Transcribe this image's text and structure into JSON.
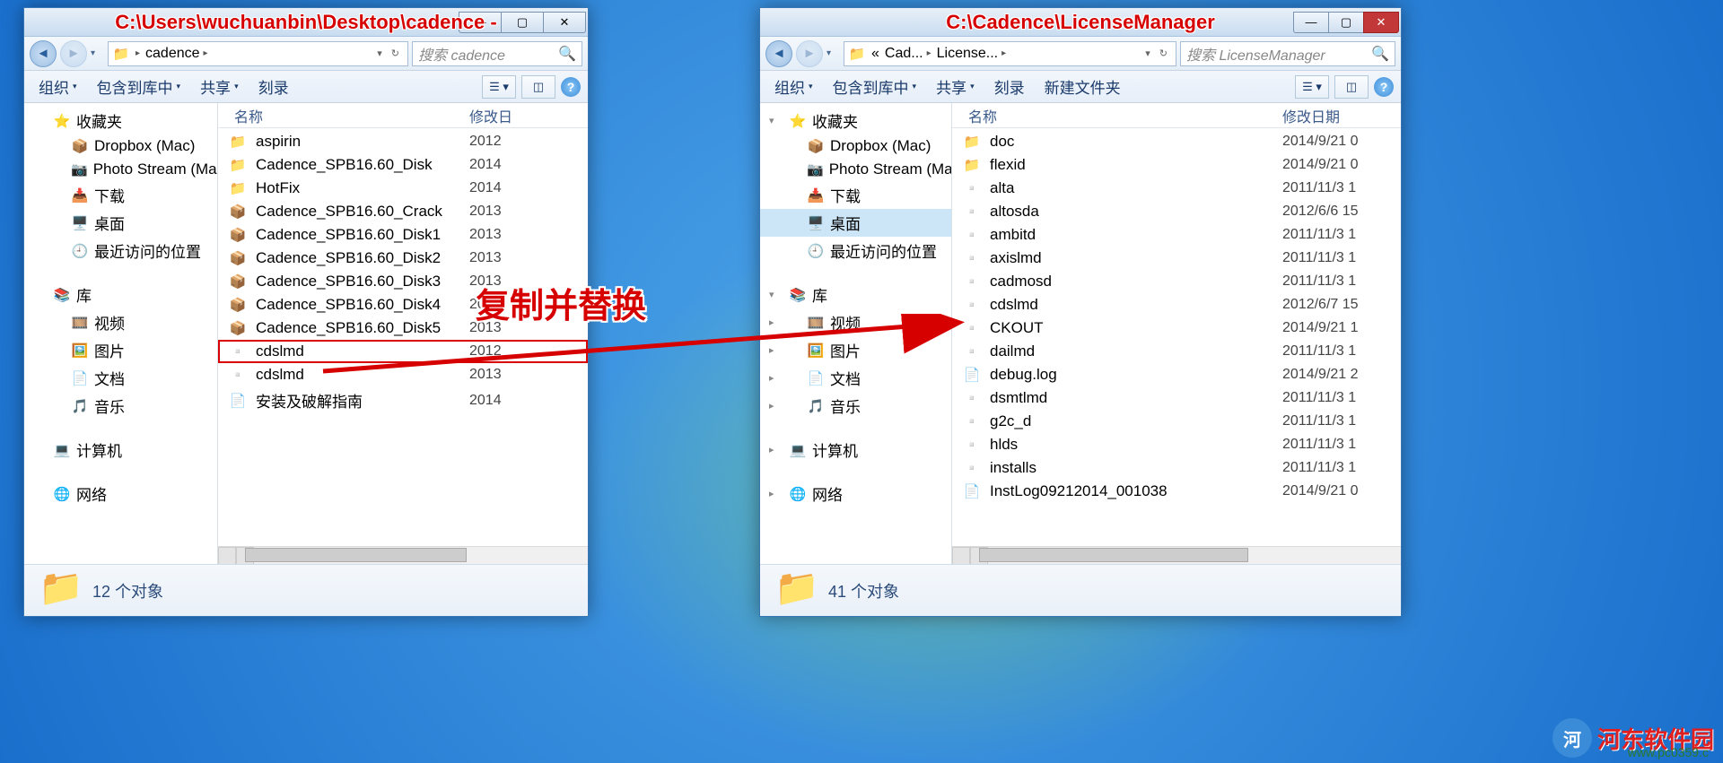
{
  "annotations": {
    "copy_replace": "复制并替换",
    "watermark_text": "河东软件园",
    "watermark_url": "www.pc0359.c"
  },
  "window1": {
    "title_path": "C:\\Users\\wuchuanbin\\Desktop\\cadence -",
    "breadcrumb": [
      "cadence"
    ],
    "search_placeholder": "搜索 cadence",
    "toolbar": {
      "organize": "组织",
      "include": "包含到库中",
      "share": "共享",
      "burn": "刻录"
    },
    "columns": {
      "name": "名称",
      "date": "修改日"
    },
    "nav": {
      "favorites": "收藏夹",
      "fav_items": [
        "Dropbox (Mac)",
        "Photo Stream (Mac)",
        "下载",
        "桌面",
        "最近访问的位置"
      ],
      "libs": "库",
      "lib_items": [
        "视频",
        "图片",
        "文档",
        "音乐"
      ],
      "computer": "计算机",
      "network": "网络"
    },
    "files": [
      {
        "icon": "folder",
        "name": "aspirin",
        "date": "2012"
      },
      {
        "icon": "folder",
        "name": "Cadence_SPB16.60_Disk",
        "date": "2014"
      },
      {
        "icon": "folder",
        "name": "HotFix",
        "date": "2014"
      },
      {
        "icon": "archive",
        "name": "Cadence_SPB16.60_Crack",
        "date": "2013"
      },
      {
        "icon": "archive",
        "name": "Cadence_SPB16.60_Disk1",
        "date": "2013"
      },
      {
        "icon": "archive",
        "name": "Cadence_SPB16.60_Disk2",
        "date": "2013"
      },
      {
        "icon": "archive",
        "name": "Cadence_SPB16.60_Disk3",
        "date": "2013"
      },
      {
        "icon": "archive",
        "name": "Cadence_SPB16.60_Disk4",
        "date": "2013"
      },
      {
        "icon": "archive",
        "name": "Cadence_SPB16.60_Disk5",
        "date": "2013"
      },
      {
        "icon": "exe",
        "name": "cdslmd",
        "date": "2012",
        "highlight": true
      },
      {
        "icon": "exe",
        "name": "cdslmd",
        "date": "2013"
      },
      {
        "icon": "text",
        "name": "安装及破解指南",
        "date": "2014"
      }
    ],
    "status": "12 个对象"
  },
  "window2": {
    "title_path": "C:\\Cadence\\LicenseManager",
    "breadcrumb": [
      "«",
      "Cad...",
      "License..."
    ],
    "search_placeholder": "搜索 LicenseManager",
    "toolbar": {
      "organize": "组织",
      "include": "包含到库中",
      "share": "共享",
      "burn": "刻录",
      "newfolder": "新建文件夹"
    },
    "columns": {
      "name": "名称",
      "date": "修改日期"
    },
    "nav": {
      "favorites": "收藏夹",
      "fav_items": [
        "Dropbox (Mac)",
        "Photo Stream (Mac)",
        "下载",
        "桌面",
        "最近访问的位置"
      ],
      "libs": "库",
      "lib_items": [
        "视频",
        "图片",
        "文档",
        "音乐"
      ],
      "computer": "计算机",
      "network": "网络"
    },
    "files": [
      {
        "icon": "folder",
        "name": "doc",
        "date": "2014/9/21 0"
      },
      {
        "icon": "folder",
        "name": "flexid",
        "date": "2014/9/21 0"
      },
      {
        "icon": "exe",
        "name": "alta",
        "date": "2011/11/3 1"
      },
      {
        "icon": "exe",
        "name": "altosda",
        "date": "2012/6/6 15"
      },
      {
        "icon": "exe",
        "name": "ambitd",
        "date": "2011/11/3 1"
      },
      {
        "icon": "exe",
        "name": "axislmd",
        "date": "2011/11/3 1"
      },
      {
        "icon": "exe",
        "name": "cadmosd",
        "date": "2011/11/3 1"
      },
      {
        "icon": "exe",
        "name": "cdslmd",
        "date": "2012/6/7 15"
      },
      {
        "icon": "exe",
        "name": "CKOUT",
        "date": "2014/9/21 1"
      },
      {
        "icon": "exe",
        "name": "dailmd",
        "date": "2011/11/3 1"
      },
      {
        "icon": "text",
        "name": "debug.log",
        "date": "2014/9/21 2"
      },
      {
        "icon": "exe",
        "name": "dsmtlmd",
        "date": "2011/11/3 1"
      },
      {
        "icon": "exe",
        "name": "g2c_d",
        "date": "2011/11/3 1"
      },
      {
        "icon": "exe",
        "name": "hlds",
        "date": "2011/11/3 1"
      },
      {
        "icon": "exe",
        "name": "installs",
        "date": "2011/11/3 1"
      },
      {
        "icon": "text",
        "name": "InstLog09212014_001038",
        "date": "2014/9/21 0"
      }
    ],
    "status": "41 个对象"
  }
}
